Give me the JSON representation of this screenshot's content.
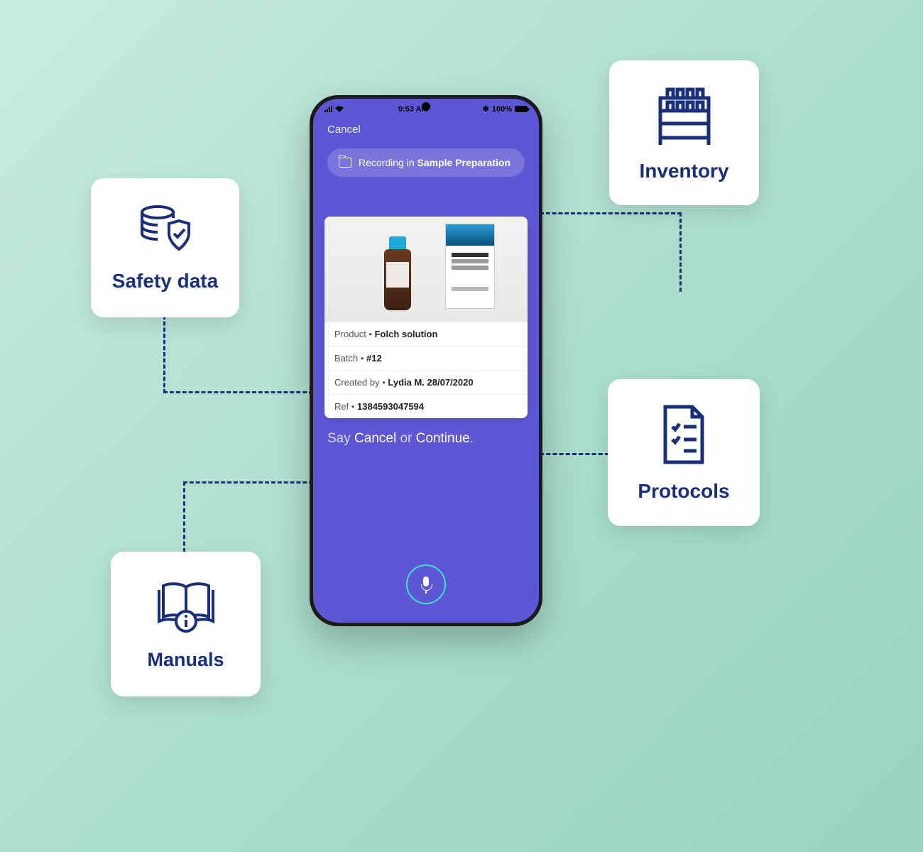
{
  "cards": {
    "safety": {
      "label": "Safety data"
    },
    "manuals": {
      "label": "Manuals"
    },
    "inventory": {
      "label": "Inventory"
    },
    "protocols": {
      "label": "Protocols"
    }
  },
  "phone": {
    "status": {
      "time": "9:53 AM",
      "battery_pct": "100%",
      "bluetooth": "✱"
    },
    "header": {
      "cancel": "Cancel"
    },
    "recording": {
      "prefix": "Recording in",
      "folder": "Sample Preparation"
    },
    "product": {
      "product_label": "Product",
      "product_value": "Folch solution",
      "batch_label": "Batch",
      "batch_value": "#12",
      "created_label": "Created by",
      "created_value": "Lydia M. 28/07/2020",
      "ref_label": "Ref",
      "ref_value": "1384593047594"
    },
    "voice_hint": {
      "say": "Say",
      "cancel": "Cancel",
      "or": "or",
      "continue": "Continue",
      "end": "."
    }
  },
  "colors": {
    "brand": "#1a2f7a",
    "app": "#5d57d6",
    "accent": "#3de0c8"
  }
}
